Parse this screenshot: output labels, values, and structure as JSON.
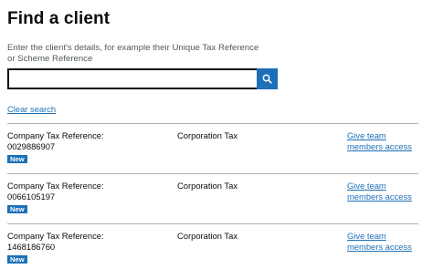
{
  "page_title": "Find a client",
  "search": {
    "hint": "Enter the client's details, for example their Unique Tax Reference or Scheme Reference",
    "value": "",
    "icon": "search-icon"
  },
  "clear_search_label": "Clear search",
  "colors": {
    "link": "#1d70b8",
    "tag_background": "#1d70b8",
    "button_background": "#1d70b8",
    "border": "#b1b4b6"
  },
  "clients": [
    {
      "ref_label": "Company Tax Reference:",
      "ref_value": "0029886907",
      "tag": "New",
      "service": "Corporation Tax",
      "action": "Give team members access"
    },
    {
      "ref_label": "Company Tax Reference:",
      "ref_value": "0066105197",
      "tag": "New",
      "service": "Corporation Tax",
      "action": "Give team members access"
    },
    {
      "ref_label": "Company Tax Reference:",
      "ref_value": "1468186760",
      "tag": "New",
      "service": "Corporation Tax",
      "action": "Give team members access"
    }
  ]
}
